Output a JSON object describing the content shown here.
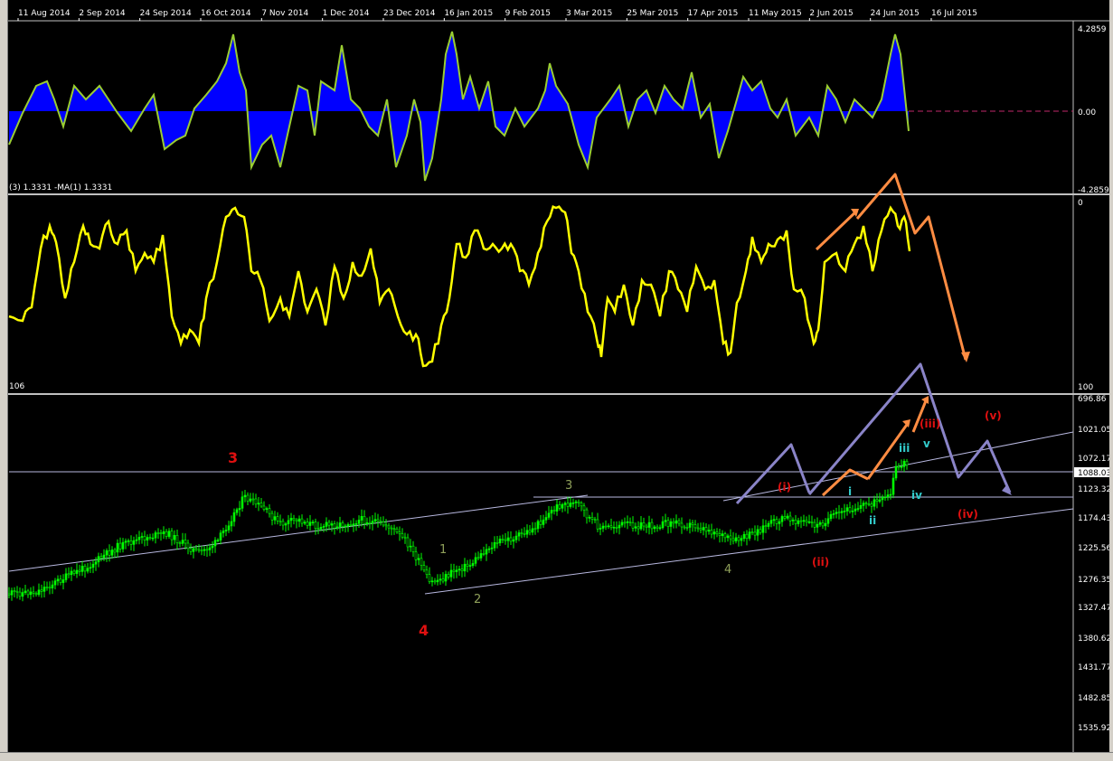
{
  "date_axis": [
    "11 Aug 2014",
    "2 Sep 2014",
    "24 Sep 2014",
    "16 Oct 2014",
    "7 Nov 2014",
    "1 Dec 2014",
    "23 Dec 2014",
    "16 Jan 2015",
    "9 Feb 2015",
    "3 Mar 2015",
    "25 Mar 2015",
    "17 Apr 2015",
    "11 May 2015",
    "2 Jun 2015",
    "24 Jun 2015",
    "16 Jul 2015"
  ],
  "oscillator": {
    "caption": "(3) 1.3331 -MA(1) 1.3331",
    "scale": [
      "4.2859",
      "0.00",
      "-4.2859"
    ]
  },
  "stochastic": {
    "scale": [
      "0",
      "100"
    ],
    "left_value": "106"
  },
  "price_scale": [
    "696.86",
    "1021.05",
    "1072.17",
    "1088.03",
    "1123.32",
    "1174.43",
    "1225.56",
    "1276.35",
    "1327.47",
    "1380.62",
    "1431.77",
    "1482.85",
    "1535.92"
  ],
  "wave_labels": {
    "big3": "3",
    "big4": "4",
    "g1": "1",
    "g2": "2",
    "g3": "3",
    "g4": "4",
    "r_i": "(i)",
    "r_ii": "(ii)",
    "r_iii": "(iii)",
    "r_iv": "(iv)",
    "r_v": "(v)",
    "c_i": "i",
    "c_ii": "ii",
    "c_iii": "iii",
    "c_iv": "iv",
    "c_v": "v"
  },
  "colors": {
    "background": "#000000",
    "oscillator_fill": "#0000ff",
    "oscillator_line": "#9acd32",
    "stochastic_line": "#ffff00",
    "candles": "#00ff00",
    "arrow_orange": "#ff8c42",
    "arrow_purple": "#8a84c8",
    "wave_red": "#e01010",
    "wave_cyan": "#33cccc"
  }
}
